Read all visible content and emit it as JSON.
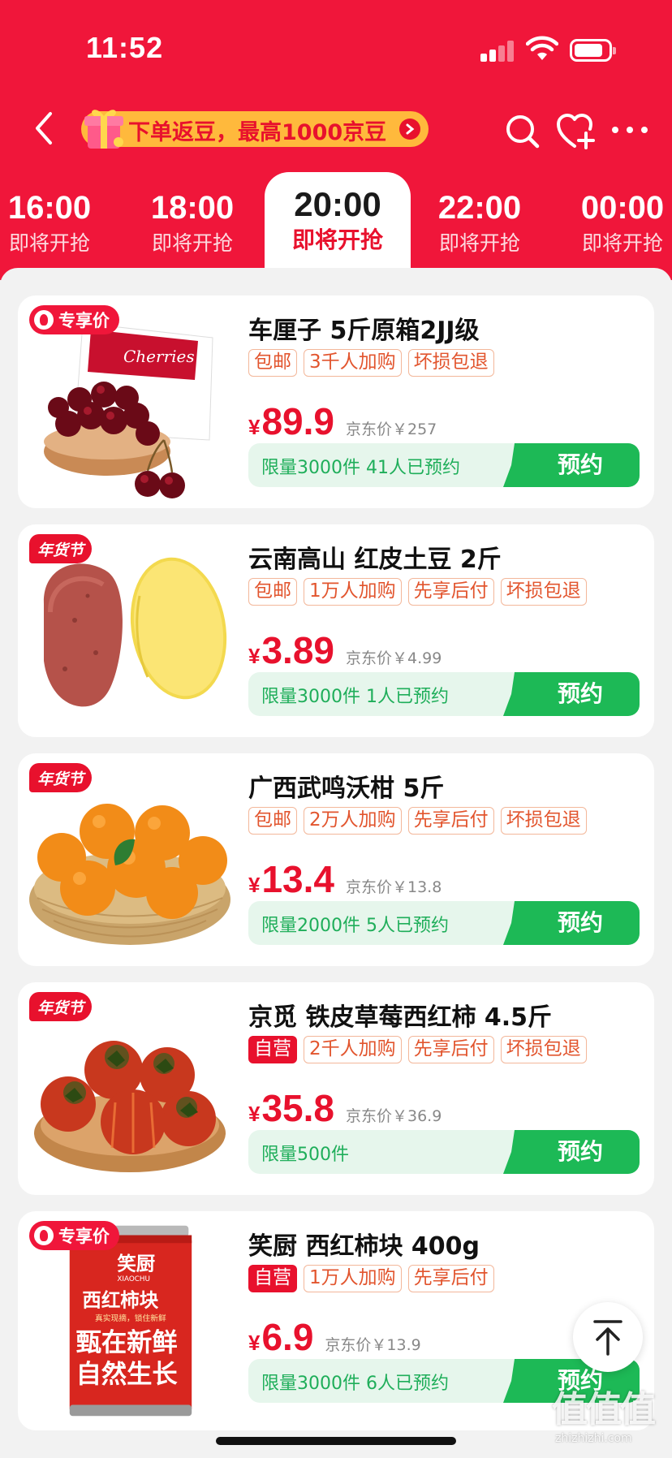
{
  "status_bar": {
    "time": "11:52"
  },
  "nav": {
    "promo_text": "下单返豆，最高1000京豆"
  },
  "time_tabs": [
    {
      "time": "16:00",
      "status": "即将开抢"
    },
    {
      "time": "18:00",
      "status": "即将开抢"
    },
    {
      "time": "20:00",
      "status": "即将开抢",
      "active": true
    },
    {
      "time": "22:00",
      "status": "即将开抢"
    },
    {
      "time": "00:00",
      "status": "即将开抢"
    }
  ],
  "products": [
    {
      "badge": "专享价",
      "badge_type": "exclusive",
      "title": "车厘子 5斤原箱2JJ级",
      "tags": [
        "包邮",
        "3千人加购",
        "坏损包退"
      ],
      "price": "89.9",
      "jd_price": "京东价￥257",
      "limit_text": "限量3000件  41人已预约",
      "button": "预约"
    },
    {
      "badge": "年货节",
      "badge_type": "newyear",
      "title": "云南高山 红皮土豆 2斤",
      "tags": [
        "包邮",
        "1万人加购",
        "先享后付",
        "坏损包退"
      ],
      "price": "3.89",
      "jd_price": "京东价￥4.99",
      "limit_text": "限量3000件  1人已预约",
      "button": "预约"
    },
    {
      "badge": "年货节",
      "badge_type": "newyear",
      "title": "广西武鸣沃柑 5斤",
      "tags": [
        "包邮",
        "2万人加购",
        "先享后付",
        "坏损包退"
      ],
      "price": "13.4",
      "jd_price": "京东价￥13.8",
      "limit_text": "限量2000件  5人已预约",
      "button": "预约"
    },
    {
      "badge": "年货节",
      "badge_type": "newyear",
      "title": "京觅 铁皮草莓西红柿 4.5斤",
      "tags": [
        "自营",
        "2千人加购",
        "先享后付",
        "坏损包退"
      ],
      "price": "35.8",
      "jd_price": "京东价￥36.9",
      "limit_text": "限量500件",
      "button": "预约"
    },
    {
      "badge": "专享价",
      "badge_type": "exclusive",
      "title": "笑厨 西红柿块 400g",
      "tags": [
        "自营",
        "1万人加购",
        "先享后付"
      ],
      "price": "6.9",
      "jd_price": "京东价￥13.9",
      "limit_text": "限量3000件  6人已预约",
      "button": "预约"
    }
  ],
  "currency_symbol": "¥",
  "can_label": {
    "brand": "笑厨",
    "brand_en": "XIAOCHU",
    "name": "西红柿块",
    "line1": "真实现摘，锁住新鲜",
    "line2": "甄在新鲜",
    "line3": "自然生长"
  },
  "cherry_box_text": "Cherries",
  "watermark": {
    "logo": "值值值",
    "url": "zhizhizhi.com"
  },
  "colors": {
    "brand_red": "#f0163a",
    "price_red": "#e8112d",
    "reserve_green": "#1db956",
    "promo_yellow": "#ffb93c"
  }
}
